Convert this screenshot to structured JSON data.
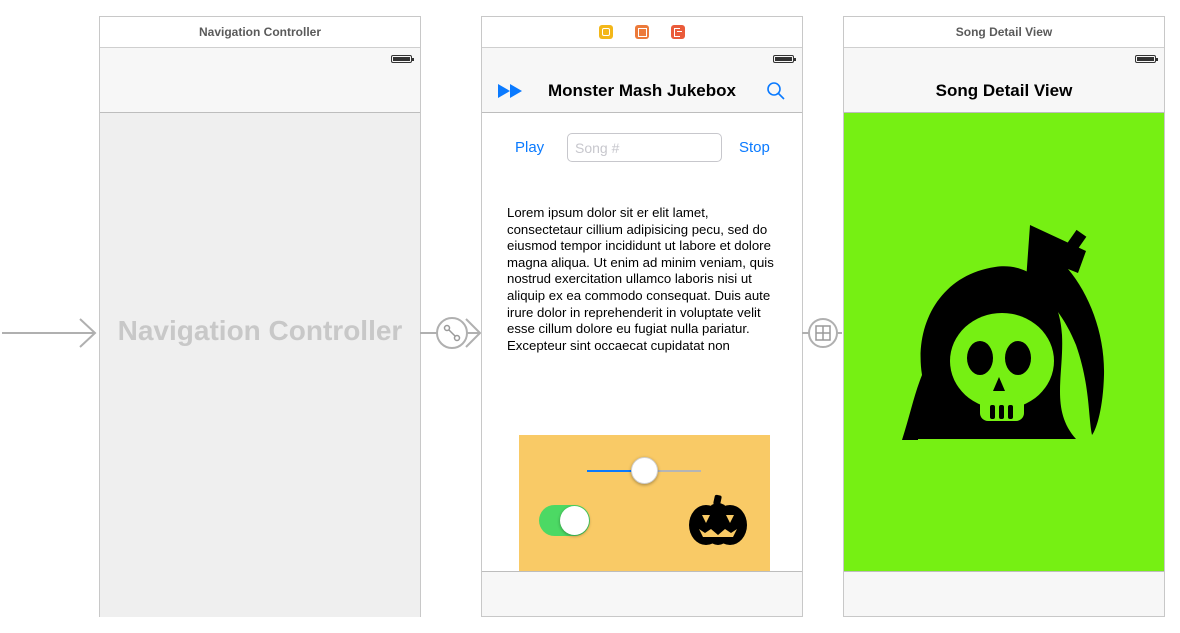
{
  "scenes": {
    "nav": {
      "title": "Navigation Controller",
      "placeholder_label": "Navigation Controller"
    },
    "jukebox": {
      "dock_icons": [
        "view-controller-icon",
        "first-responder-icon",
        "exit-icon"
      ],
      "nav_title": "Monster Mash Jukebox",
      "play_label": "Play",
      "song_placeholder": "Song #",
      "stop_label": "Stop",
      "lorem": "Lorem ipsum dolor sit er elit lamet, consectetaur cillium adipisicing pecu, sed do eiusmod tempor incididunt ut labore et dolore magna aliqua. Ut enim ad minim veniam, quis nostrud exercitation ullamco laboris nisi ut aliquip ex ea commodo consequat. Duis aute irure dolor in reprehenderit in voluptate velit esse cillum dolore eu fugiat nulla pariatur. Excepteur sint occaecat cupidatat non",
      "slider_value": 0.5,
      "toggle_on": true
    },
    "detail": {
      "title": "Song Detail View",
      "nav_title": "Song Detail View",
      "background": "#76f013"
    }
  },
  "colors": {
    "ios_blue": "#0a7aff",
    "panel": "#f9ca66",
    "toggle_on": "#4cd964"
  }
}
